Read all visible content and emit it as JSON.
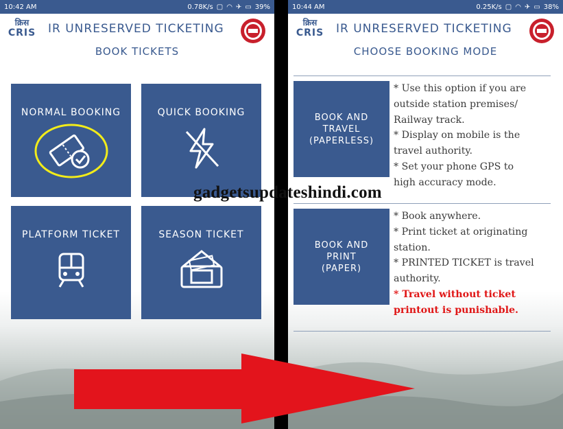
{
  "colors": {
    "primary": "#3a5a8f",
    "warning": "#e01616",
    "highlight_ring": "#f2ec1a",
    "arrow": "#e3141c"
  },
  "left": {
    "status": {
      "time": "10:42 AM",
      "speed": "0.78K/s",
      "battery": "39%"
    },
    "header": {
      "logo_hindi": "क्रिस",
      "logo_text": "CRIS",
      "title": "IR UNRESERVED TICKETING"
    },
    "subtitle": "BOOK TICKETS",
    "tiles": [
      {
        "label": "NORMAL BOOKING",
        "icon": "ticket-check-icon"
      },
      {
        "label": "QUICK BOOKING",
        "icon": "lightning-off-icon"
      },
      {
        "label": "PLATFORM TICKET",
        "icon": "train-icon"
      },
      {
        "label": "SEASON TICKET",
        "icon": "season-ticket-icon"
      }
    ]
  },
  "right": {
    "status": {
      "time": "10:44 AM",
      "speed": "0.25K/s",
      "battery": "38%"
    },
    "header": {
      "logo_hindi": "क्रिस",
      "logo_text": "CRIS",
      "title": "IR UNRESERVED TICKETING"
    },
    "subtitle": "CHOOSE BOOKING MODE",
    "modes": [
      {
        "button_lines": [
          "BOOK AND",
          "TRAVEL",
          "(PAPERLESS)"
        ],
        "description": [
          "* Use this option if you are",
          "outside station premises/",
          "Railway track.",
          "* Display on mobile is the",
          "travel authority.",
          "* Set your phone GPS to",
          "high accuracy mode."
        ]
      },
      {
        "button_lines": [
          "BOOK AND",
          "PRINT",
          "(PAPER)"
        ],
        "description": [
          "* Book anywhere.",
          "* Print ticket at originating",
          "station.",
          "* PRINTED TICKET is travel",
          "authority."
        ],
        "warning": [
          "* Travel without ticket",
          "printout is punishable."
        ]
      }
    ]
  },
  "watermark": "gadgetsupdateshindi.com"
}
